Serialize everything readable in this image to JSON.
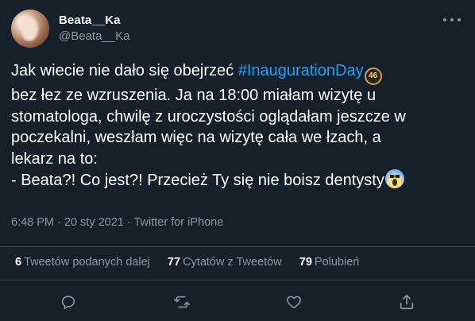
{
  "tweet": {
    "author": {
      "display_name": "Beata__Ka",
      "handle": "@Beata__Ka"
    },
    "text_lines": [
      {
        "before": "Jak wiecie nie dało się obejrzeć ",
        "hashtag": "#InaugurationDay",
        "emoji_text": "46"
      },
      {
        "text": "bez łez ze wzruszenia. Ja na 18:00 miałam wizytę u"
      },
      {
        "text": "stomatologa, chwilę z uroczystości oglądałam jeszcze w"
      },
      {
        "text": "poczekalni, weszłam więc na wizytę cała we łzach, a"
      },
      {
        "text": "lekarz na to:"
      },
      {
        "text": "- Beata?! Co jest?! Przecież Ty się nie boisz dentysty"
      }
    ],
    "emojis": [
      "inauguration-46-emoji",
      "scream-emoji"
    ],
    "meta": "6:48 PM · 20 sty 2021 · Twitter for iPhone",
    "stats": {
      "retweets_count": "6",
      "retweets_label": "Tweetów podanych dalej",
      "quotes_count": "77",
      "quotes_label": "Cytatów z Tweetów",
      "likes_count": "79",
      "likes_label": "Polubień"
    },
    "actions": [
      {
        "name": "reply",
        "icon": "reply-icon"
      },
      {
        "name": "retweet",
        "icon": "retweet-icon"
      },
      {
        "name": "like",
        "icon": "heart-icon"
      },
      {
        "name": "share",
        "icon": "share-icon"
      }
    ]
  },
  "colors": {
    "background": "#15202b",
    "text": "#ffffff",
    "secondary": "#8899a6",
    "hashtag": "#1da1f2",
    "divider": "#38444d"
  }
}
